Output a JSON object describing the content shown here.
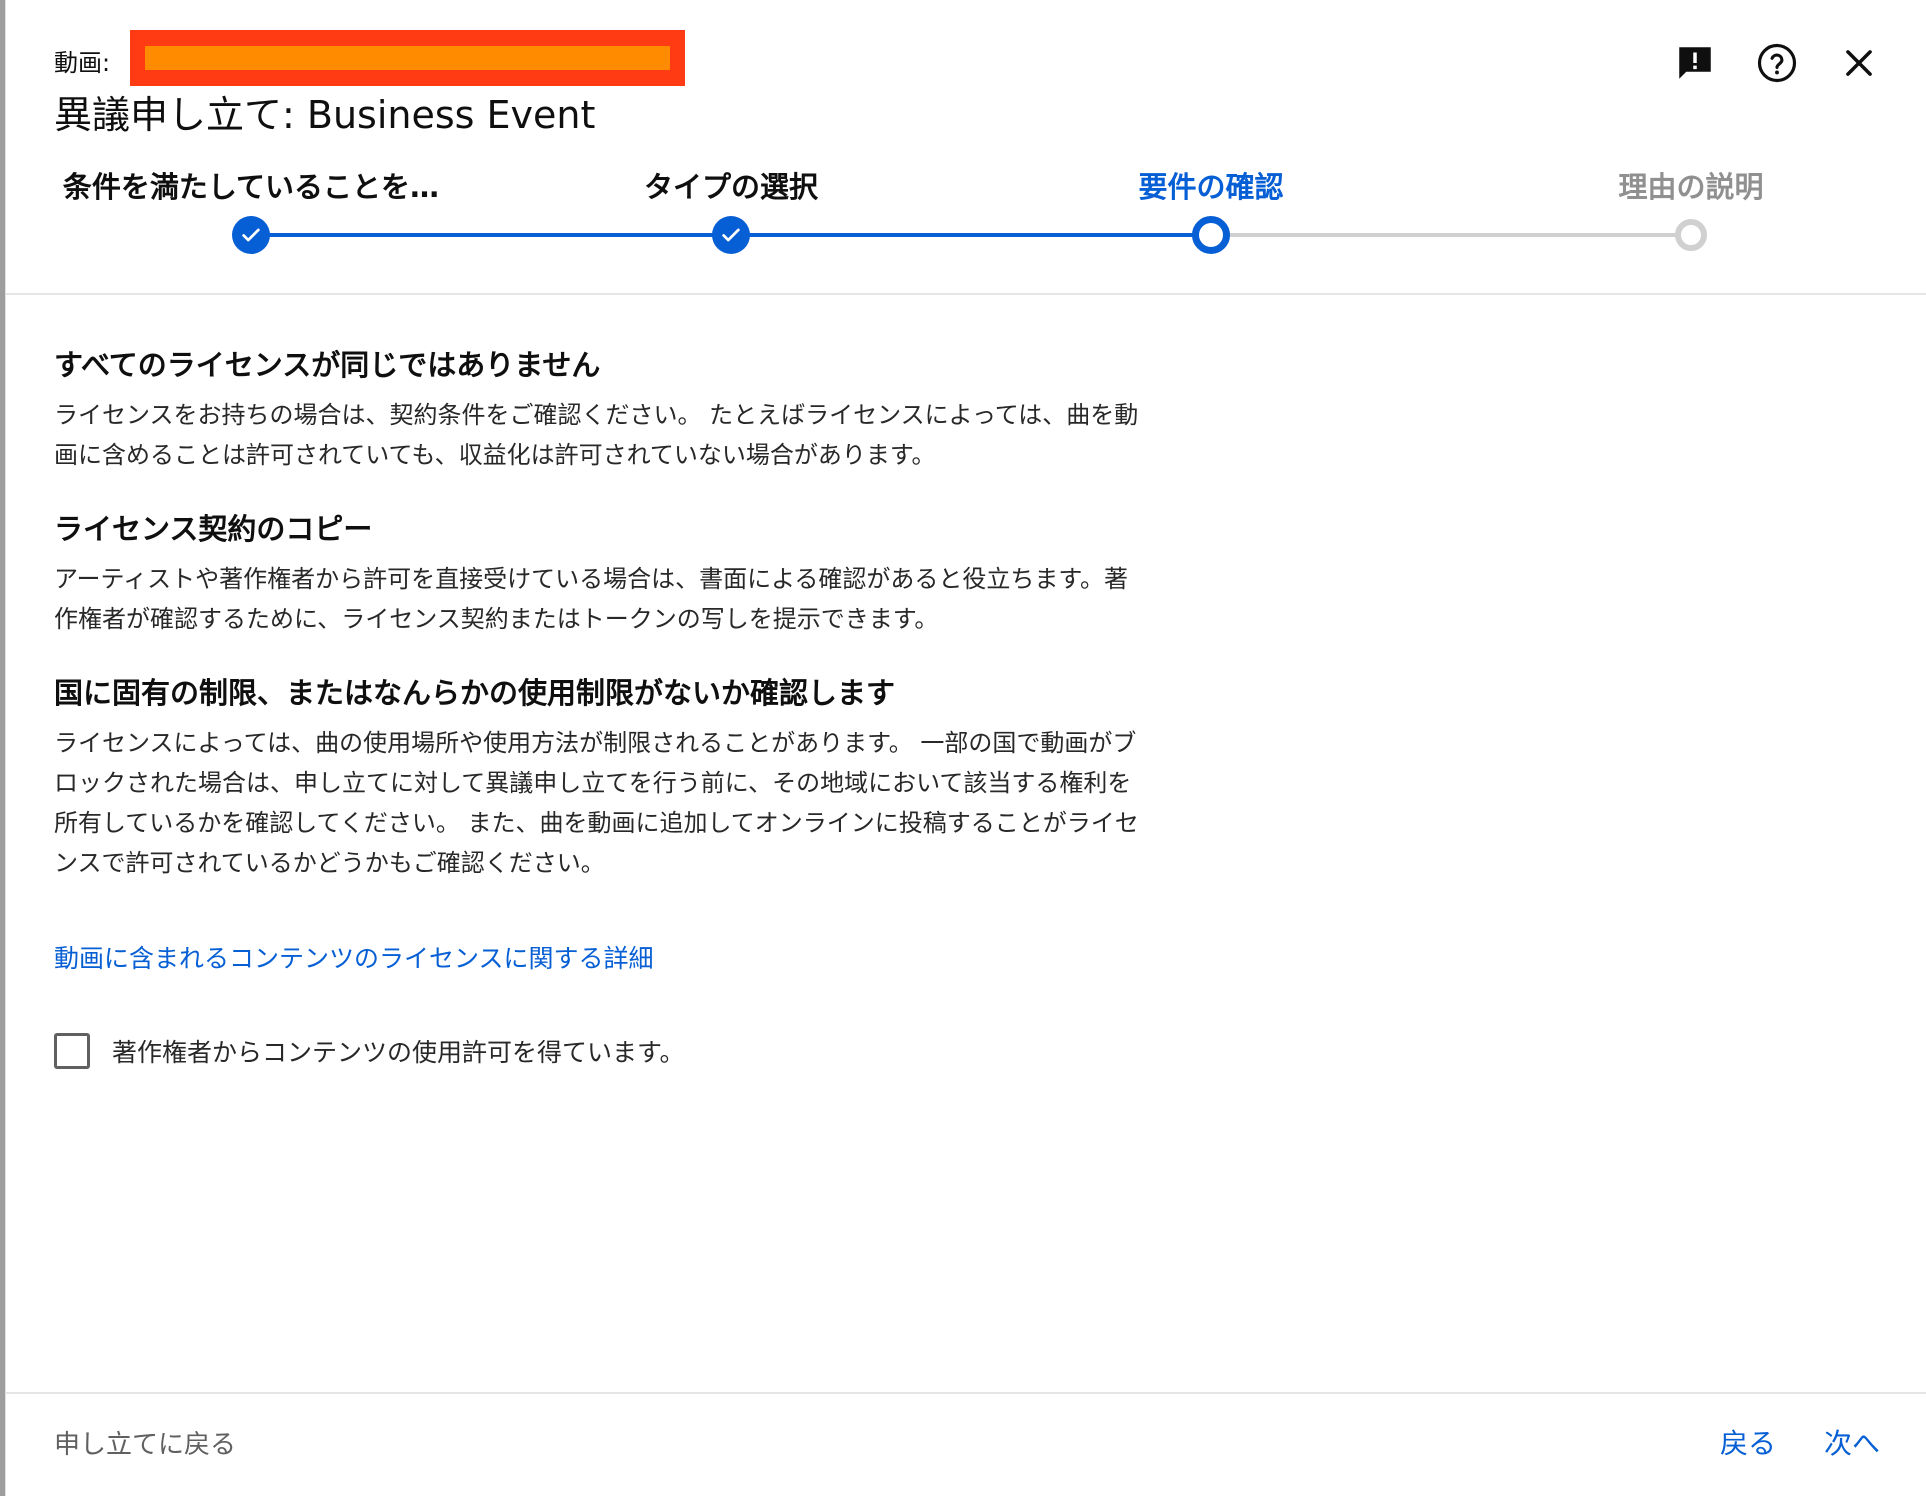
{
  "header": {
    "video_label": "動画:",
    "title": "異議申し立て: Business Event",
    "icons": [
      "feedback-icon",
      "help-icon",
      "close-icon"
    ]
  },
  "stepper": {
    "steps": [
      {
        "label": "条件を満たしていることを…",
        "state": "done"
      },
      {
        "label": "タイプの選択",
        "state": "done"
      },
      {
        "label": "要件の確認",
        "state": "current"
      },
      {
        "label": "理由の説明",
        "state": "todo"
      }
    ]
  },
  "content": {
    "sections": [
      {
        "heading": "すべてのライセンスが同じではありません",
        "lines": [
          "ライセンスをお持ちの場合は、契約条件をご確認ください。 たとえばライセンスによっては、曲を動",
          "画に含めることは許可されていても、収益化は許可されていない場合があります。"
        ]
      },
      {
        "heading": "ライセンス契約のコピー",
        "lines": [
          "アーティストや著作権者から許可を直接受けている場合は、書面による確認があると役立ちます。著",
          "作権者が確認するために、ライセンス契約またはトークンの写しを提示できます。"
        ]
      },
      {
        "heading": "国に固有の制限、またはなんらかの使用制限がないか確認します",
        "lines": [
          "ライセンスによっては、曲の使用場所や使用方法が制限されることがあります。 一部の国で動画がブ",
          "ロックされた場合は、申し立てに対して異議申し立てを行う前に、その地域において該当する権利を",
          "所有しているかを確認してください。 また、曲を動画に追加してオンラインに投稿することがライセ",
          "ンスで許可されているかどうかもご確認ください。"
        ]
      }
    ],
    "link": "動画に含まれるコンテンツのライセンスに関する詳細",
    "checkbox_label": "著作権者からコンテンツの使用許可を得ています。",
    "checkbox_checked": false
  },
  "footer": {
    "back_to_claim": "申し立てに戻る",
    "back": "戻る",
    "next": "次へ"
  },
  "colors": {
    "accent": "#065fd4",
    "inactive": "#d0d0d0",
    "redaction": "#ff3b14",
    "redaction_inner": "#ff8c00"
  }
}
